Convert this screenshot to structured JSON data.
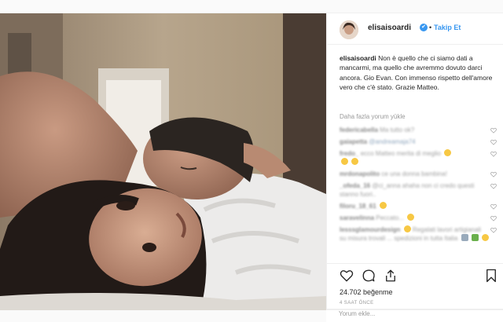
{
  "header": {
    "username": "elisaisoardi",
    "verified_badge": "✔",
    "separator": "•",
    "follow_label": "Takip Et"
  },
  "caption": {
    "username": "elisaisoardi",
    "text": "Non è quello che ci siamo dati a mancarmi, ma quello che avremmo dovuto darci ancora. Gio Evan. Con immenso rispetto dell'amore vero che c'è stato. Grazie Matteo."
  },
  "load_more_label": "Daha fazla yorum yükle",
  "comments": [
    {
      "user": "federicabella",
      "text": "Ma tutto ok?",
      "emoji": []
    },
    {
      "user": "gaiapetta",
      "text": "@andreamaja74",
      "link": true,
      "emoji": []
    },
    {
      "user": "fredo_",
      "text": "ecco Matteo merita di meglio",
      "emoji": [
        "smile",
        "smile"
      ]
    },
    {
      "user": "mrdonapolito",
      "text": "ce una donna bambina!",
      "emoji": []
    },
    {
      "user": "_ofeda_16",
      "text": "@ci_anna ahaha non ci credo questi stanno fuori..",
      "emoji": []
    },
    {
      "user": "filoru_18_61",
      "text": "",
      "emoji": [
        "smile"
      ]
    },
    {
      "user": "saravelinna",
      "text": "Peccato...",
      "emoji": [
        "smile"
      ]
    },
    {
      "user": "lesssglamourdesign",
      "text": "Regalati lavori artigianali su misura trovali ... spedizioni in tutta Italia",
      "emoji": [
        "smile",
        "box",
        "gift",
        "smile"
      ]
    }
  ],
  "actions": {
    "like": "heart-icon",
    "comment": "comment-icon",
    "share": "share-icon",
    "save": "bookmark-icon"
  },
  "likes_text": "24.702 beğenme",
  "timestamp": "4 SAAT ÖNCE",
  "add_comment_placeholder": "Yorum ekle...",
  "colors": {
    "accent": "#3897f0",
    "text": "#262626",
    "muted": "#999999"
  }
}
